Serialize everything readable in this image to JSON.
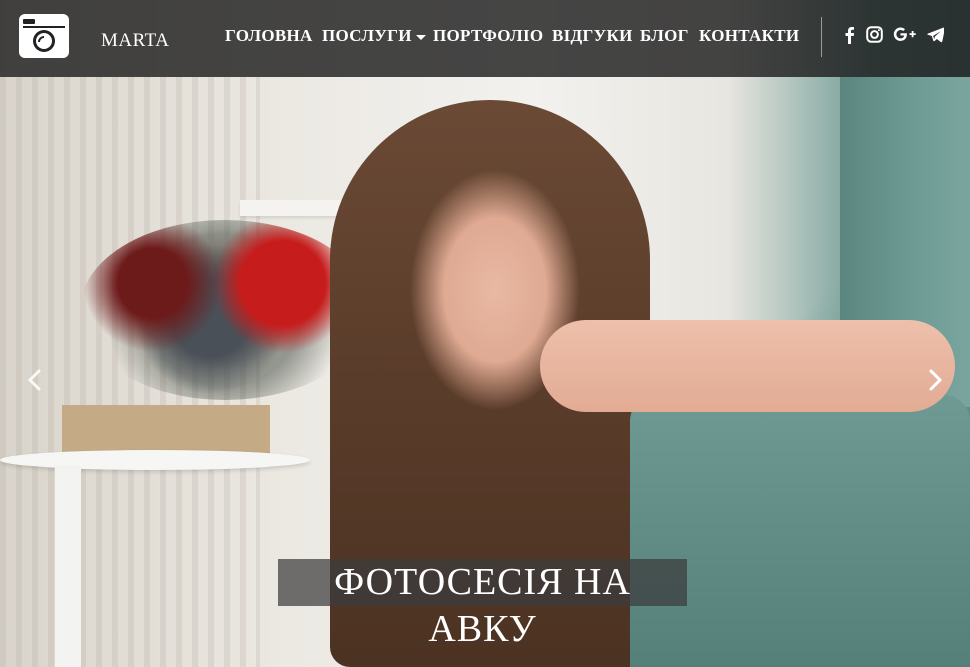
{
  "brand": {
    "name": "MARTA",
    "logo_icon": "camera-icon"
  },
  "nav": {
    "items": [
      {
        "label": "ГОЛОВНА"
      },
      {
        "label": "ПОСЛУГИ",
        "has_dropdown": true
      },
      {
        "label": "ПОРТФОЛІО"
      },
      {
        "label": "ВІДГУКИ"
      },
      {
        "label": "БЛОГ"
      },
      {
        "label": "КОНТАКТИ"
      }
    ]
  },
  "social": [
    "facebook-icon",
    "instagram-icon",
    "google-plus-icon",
    "telegram-icon"
  ],
  "carousel": {
    "caption": "ФОТОСЕСІЯ НА АВКУ",
    "prev_icon": "chevron-left-icon",
    "next_icon": "chevron-right-icon"
  },
  "colors": {
    "navbar_bg": "#1e1e1e",
    "text": "#ffffff",
    "caption_bg": "#3c3c3c"
  }
}
